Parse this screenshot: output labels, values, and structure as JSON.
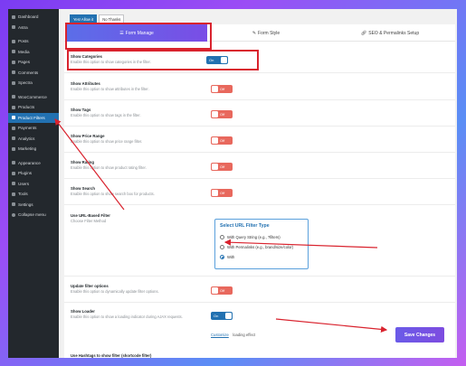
{
  "sidebar": {
    "items": [
      {
        "label": "Dashboard"
      },
      {
        "label": "Astra"
      },
      {
        "label": "Posts"
      },
      {
        "label": "Media"
      },
      {
        "label": "Pages"
      },
      {
        "label": "Comments"
      },
      {
        "label": "Spectra"
      },
      {
        "label": "WooCommerce"
      },
      {
        "label": "Products"
      },
      {
        "label": "Product Filters"
      },
      {
        "label": "Payments"
      },
      {
        "label": "Analytics"
      },
      {
        "label": "Marketing"
      },
      {
        "label": "Appearance"
      },
      {
        "label": "Plugins"
      },
      {
        "label": "Users"
      },
      {
        "label": "Tools"
      },
      {
        "label": "Settings"
      },
      {
        "label": "Collapse menu"
      }
    ]
  },
  "top_tabs": {
    "yes": "Yes! Allow it",
    "no": "No Thanks"
  },
  "tabs": {
    "form_manage": "Form Manage",
    "form_style": "Form Style",
    "seo": "SEO & Permalinks Setup"
  },
  "settings": {
    "show_categories": {
      "title": "Show Categories",
      "desc": "Enable this option to show categories in the filter.",
      "toggle": "On"
    },
    "show_attributes": {
      "title": "Show Attributes",
      "desc": "Enable this option to show attributes in the filter.",
      "toggle": "Off"
    },
    "show_tags": {
      "title": "Show Tags",
      "desc": "Enable this option to show tags in the filter.",
      "toggle": "Off"
    },
    "show_price_range": {
      "title": "Show Price Range",
      "desc": "Enable this option to show price range filter.",
      "toggle": "Off"
    },
    "show_rating": {
      "title": "Show Rating",
      "desc": "Enable this option to show product rating filter.",
      "toggle": "Off"
    },
    "show_search": {
      "title": "Show Search",
      "desc": "Enable this option to show search box for products.",
      "toggle": "Off"
    },
    "url_filter": {
      "title": "Use URL-Based Filter",
      "desc": "Choose Filter Method"
    },
    "update_filter": {
      "title": "Update filter options",
      "desc": "Enable this option to dynamically update filter options.",
      "toggle": "Off"
    },
    "show_loader": {
      "title": "Show Loader",
      "desc": "Enable this option to show a loading indicator during AJAX requests.",
      "toggle": "On",
      "customize": "Customize",
      "customize_suffix": "loading effect"
    }
  },
  "url_filter_box": {
    "legend": "Select URL Filter Type",
    "options": [
      {
        "label": "With Query String (e.g., ?filters)"
      },
      {
        "label": "With Permalinks (e.g., brand/size/color)"
      },
      {
        "label": "With"
      }
    ],
    "selected_index": 2
  },
  "save_button": "Save Changes",
  "bottom_text": "Use Hashtags to show filter (shortcode filter)",
  "colors": {
    "accent": "#2271b1",
    "off": "#e8685d",
    "annotation": "#d9232e",
    "button": "#6a5be8"
  }
}
